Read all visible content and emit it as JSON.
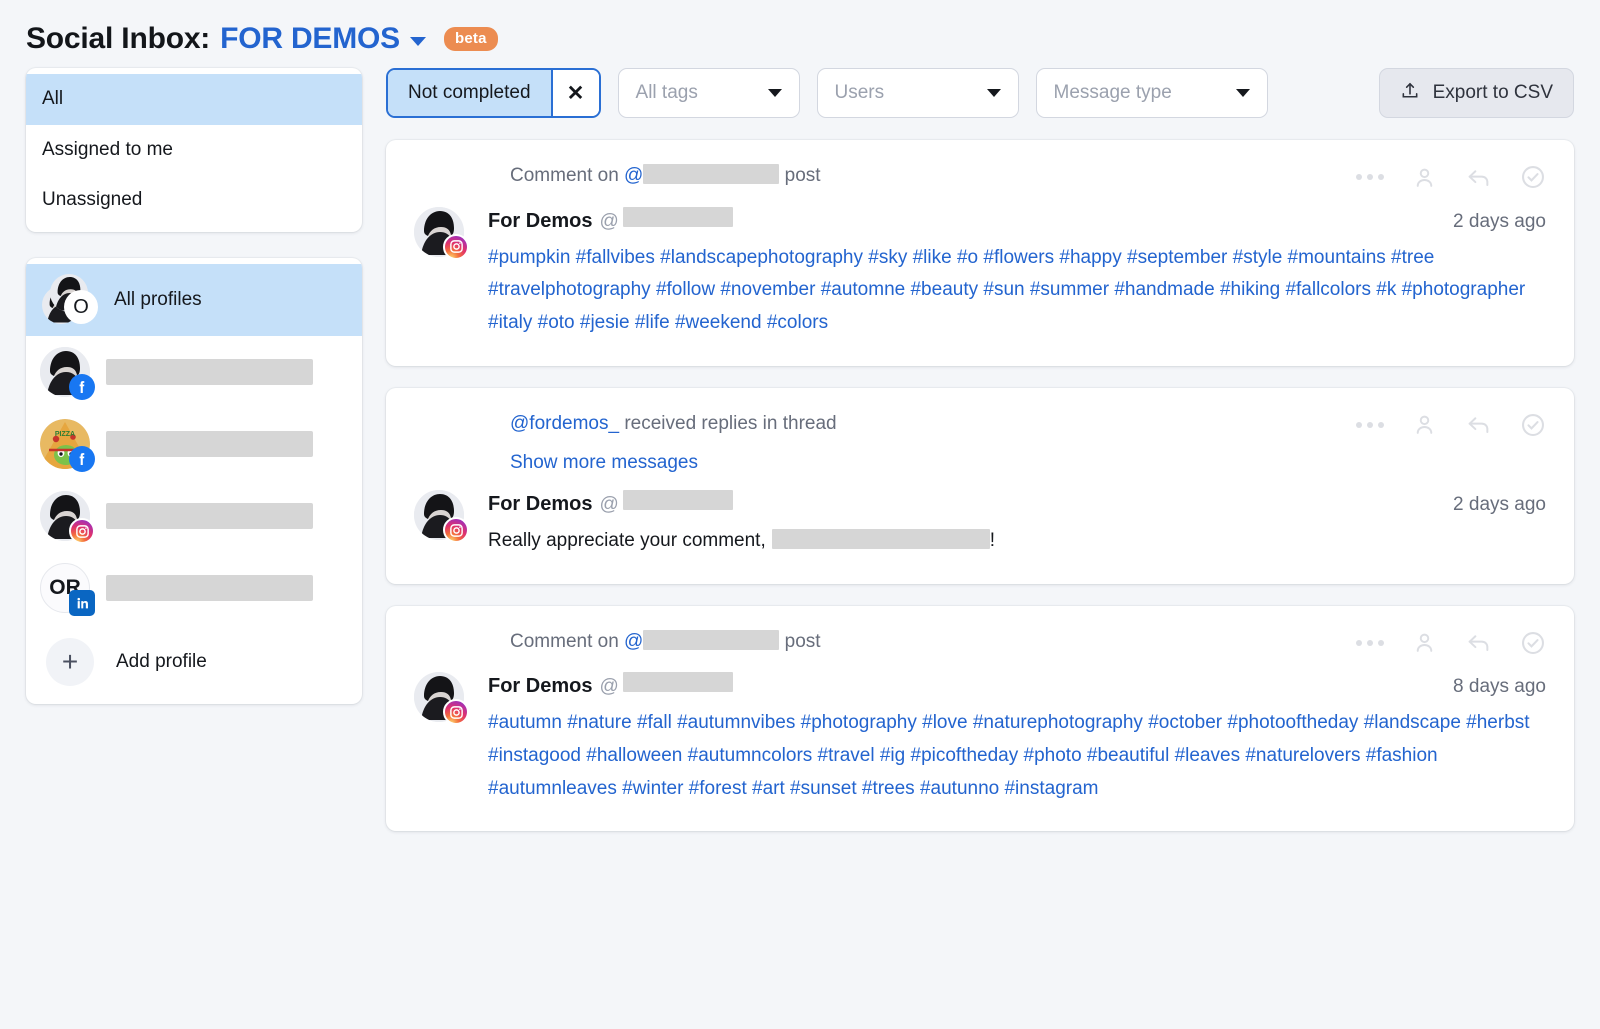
{
  "header": {
    "title": "Social Inbox:",
    "account": "FOR DEMOS",
    "badge": "beta",
    "chevron_icon": "chevron-down-icon"
  },
  "sidebar": {
    "scopes": [
      {
        "label": "All",
        "active": true
      },
      {
        "label": "Assigned to me",
        "active": false
      },
      {
        "label": "Unassigned",
        "active": false
      }
    ],
    "profiles": {
      "all_profiles_label": "All profiles",
      "all_profiles_badge": "O",
      "items": [
        {
          "network": "facebook",
          "name_redacted": true,
          "initials": ""
        },
        {
          "network": "facebook",
          "name_redacted": true,
          "initials": ""
        },
        {
          "network": "instagram",
          "name_redacted": true,
          "initials": ""
        },
        {
          "network": "linkedin",
          "name_redacted": true,
          "initials": "OR"
        }
      ],
      "add_profile_label": "Add profile",
      "add_icon": "plus-icon"
    }
  },
  "filters": {
    "active_chip": {
      "label": "Not completed",
      "clear_icon": "close-icon"
    },
    "tags": {
      "placeholder": "All tags"
    },
    "users": {
      "placeholder": "Users"
    },
    "message_type": {
      "placeholder": "Message type"
    },
    "export": {
      "label": "Export to CSV",
      "icon": "upload-icon"
    }
  },
  "messages": [
    {
      "context_prefix": "Comment on ",
      "context_at": "@",
      "context_redacted": true,
      "context_suffix": " post",
      "author": "For Demos",
      "handle_at": "@",
      "handle_redacted": true,
      "time": "2 days ago",
      "network": "instagram",
      "body": "#pumpkin #fallvibes #landscapephotography #sky #like #o #flowers #happy #september #style #mountains #tree #travelphotography #follow #november #automne #beauty #sun #summer #handmade #hiking #fallcolors #k #photographer #italy #oto #jesie #life #weekend #colors",
      "body_style": "link",
      "show_more": null
    },
    {
      "context_prefix": "",
      "context_at": "@fordemos_",
      "context_redacted": false,
      "context_suffix": " received replies in thread",
      "author": "For Demos",
      "handle_at": "@",
      "handle_redacted": true,
      "time": "2 days ago",
      "network": "instagram",
      "body": "Really appreciate your comment,",
      "body_suffix": "!",
      "body_style": "plain",
      "body_redacted": true,
      "show_more": "Show more messages"
    },
    {
      "context_prefix": "Comment on ",
      "context_at": "@",
      "context_redacted": true,
      "context_suffix": " post",
      "author": "For Demos",
      "handle_at": "@",
      "handle_redacted": true,
      "time": "8 days ago",
      "network": "instagram",
      "body": "#autumn #nature #fall #autumnvibes #photography #love #naturephotography #october #photooftheday #landscape #herbst #instagood #halloween #autumncolors #travel #ig #picoftheday #photo #beautiful #leaves #naturelovers #fashion #autumnleaves #winter #forest #art #sunset #trees #autunno #instagram",
      "body_style": "link",
      "show_more": null
    }
  ],
  "row_actions": {
    "more_icon": "ellipsis-icon",
    "assign_icon": "person-icon",
    "reply_icon": "reply-arrow-icon",
    "complete_icon": "check-circle-icon"
  },
  "colors": {
    "accent_blue": "#2364cf",
    "highlight_blue": "#c5e0f9",
    "beta_orange": "#ec8c51",
    "page_bg": "#f4f6f9",
    "redact_gray": "#d6d6d6"
  }
}
